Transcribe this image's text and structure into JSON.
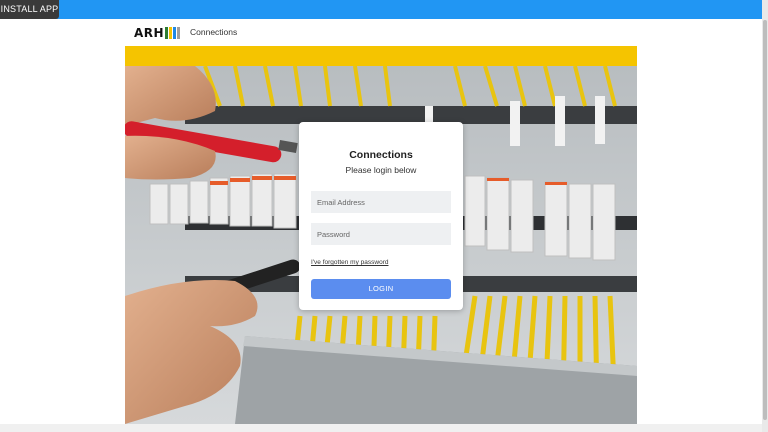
{
  "top_bar": {
    "install_label": "INSTALL APP"
  },
  "header": {
    "logo_text": "ARH",
    "logo_colors": [
      "#2e7d32",
      "#f5c400",
      "#1e88e5",
      "#9e9e9e"
    ],
    "nav_link": "Connections"
  },
  "login": {
    "title": "Connections",
    "subtitle": "Please login below",
    "email_placeholder": "Email Address",
    "password_placeholder": "Password",
    "forgot_link": "I've forgotten my password",
    "login_button": "LOGIN"
  },
  "colors": {
    "top_bar": "#2196f3",
    "accent_yellow": "#f5c400",
    "login_button": "#5b8def"
  },
  "hero": {
    "image_subject": "electrician testing terminal block wiring with multimeter probes"
  }
}
